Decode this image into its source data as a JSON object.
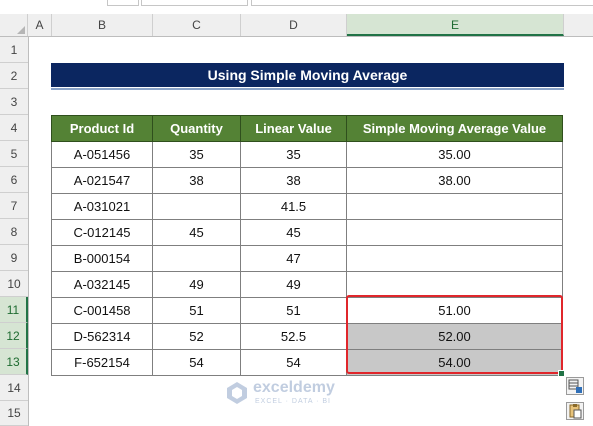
{
  "columns": [
    "A",
    "B",
    "C",
    "D",
    "E"
  ],
  "rows": [
    "1",
    "2",
    "3",
    "4",
    "5",
    "6",
    "7",
    "8",
    "9",
    "10",
    "11",
    "12",
    "13",
    "14",
    "15"
  ],
  "title": "Using Simple Moving Average",
  "table": {
    "headers": [
      "Product Id",
      "Quantity",
      "Linear Value",
      "Simple Moving Average Value"
    ],
    "rows": [
      [
        "A-051456",
        "35",
        "35",
        "35.00"
      ],
      [
        "A-021547",
        "38",
        "38",
        "38.00"
      ],
      [
        "A-031021",
        "",
        "41.5",
        ""
      ],
      [
        "C-012145",
        "45",
        "45",
        ""
      ],
      [
        "B-000154",
        "",
        "47",
        ""
      ],
      [
        "A-032145",
        "49",
        "49",
        ""
      ],
      [
        "C-001458",
        "51",
        "51",
        "51.00"
      ],
      [
        "D-562314",
        "52",
        "52.5",
        "52.00"
      ],
      [
        "F-652154",
        "54",
        "54",
        "54.00"
      ]
    ]
  },
  "watermark": {
    "name": "exceldemy",
    "tagline": "EXCEL · DATA · BI"
  },
  "colors": {
    "title_banner": "#0b2660",
    "table_header": "#548235",
    "selection_border": "#e0262b",
    "shaded_cell": "#c8c8c8"
  },
  "icons": {
    "quick_analysis": "quick-analysis-icon",
    "paste_options": "paste-options-icon",
    "watermark_logo": "exceldemy-logo-icon"
  }
}
